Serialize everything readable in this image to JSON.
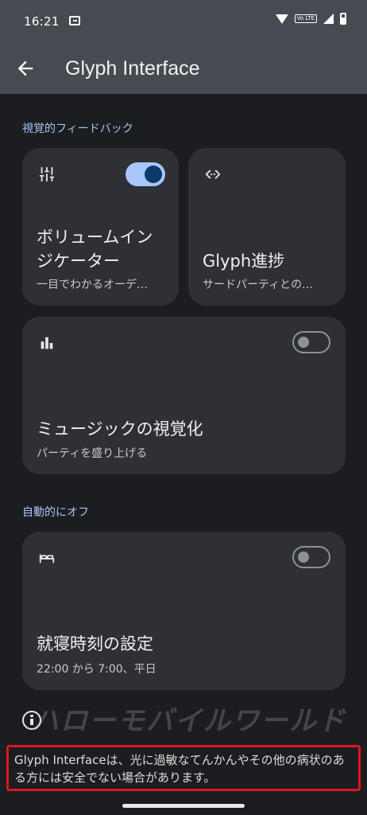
{
  "status_bar": {
    "time": "16:21",
    "network_label": "Vo LTE"
  },
  "app_bar": {
    "title": "Glyph Interface"
  },
  "sections": {
    "visual_feedback": "視覚的フィードバック",
    "auto_off": "自動的にオフ"
  },
  "cards": {
    "volume": {
      "title_line1": "ボリュームイン",
      "title_line2": "ジケーター",
      "subtitle": "一目でわかるオーデ…",
      "toggle_on": true
    },
    "progress": {
      "title": "Glyph進捗",
      "subtitle": "サードパーティとの…"
    },
    "music": {
      "title": "ミュージックの視覚化",
      "subtitle": "パーティを盛り上げる",
      "toggle_on": false
    },
    "bedtime": {
      "title": "就寝時刻の設定",
      "subtitle": "22:00 から 7:00、平日",
      "toggle_on": false
    }
  },
  "watermark": "ハローモバイルワールド",
  "warning": "Glyph Interfaceは、光に過敏なてんかんやその他の病状のある方には安全でない場合があります。",
  "colors": {
    "accent": "#a8c7fa",
    "highlight_border": "#e0141e",
    "app_bar": "#474a50",
    "card": "#2e3036"
  }
}
